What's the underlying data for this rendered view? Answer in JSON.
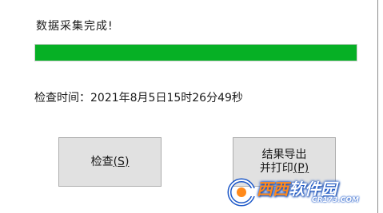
{
  "status": {
    "title": "数据采集完成!"
  },
  "progress": {
    "value": 1.0,
    "color": "#06b025"
  },
  "check_time": {
    "text": "检查时间：2021年8月5日15时26分49秒"
  },
  "buttons": {
    "check": {
      "label": "检查",
      "mnemonic": "(S)"
    },
    "export": {
      "line1": "结果导出",
      "line2_prefix": "并打印",
      "line2_mnemonic": "(P)"
    }
  },
  "watermark": {
    "brand_a": "西西",
    "brand_b": "软件园",
    "domain": "CR173.COM"
  }
}
